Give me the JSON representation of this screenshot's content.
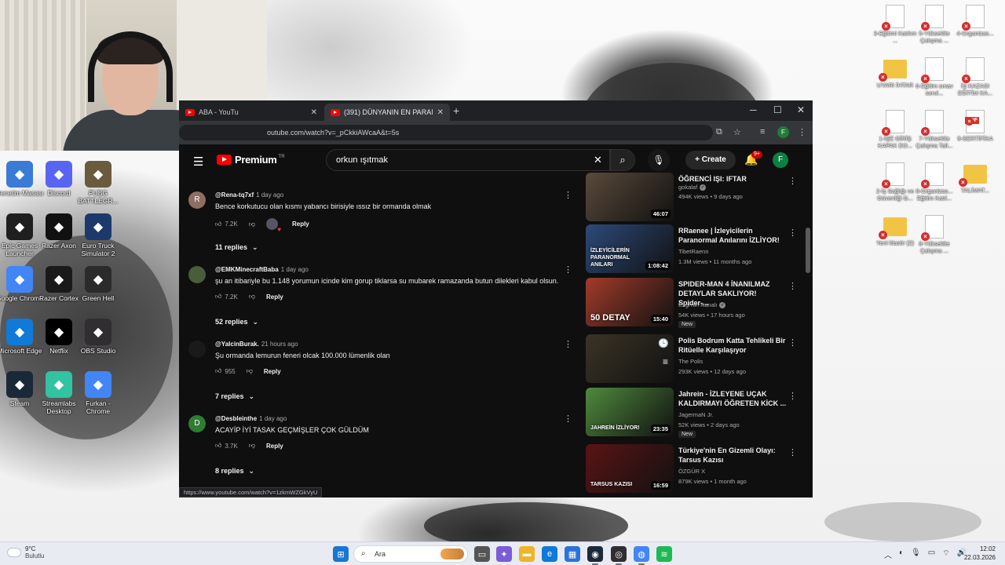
{
  "desktop": {
    "left_icons": [
      {
        "label": "Denetim Masası",
        "icon": "control-panel-icon",
        "color": "#3a7bd5"
      },
      {
        "label": "Discord",
        "icon": "discord-icon",
        "color": "#5865f2"
      },
      {
        "label": "PUBG BATTLEGR...",
        "icon": "pubg-icon",
        "color": "#6b5b3e"
      },
      {
        "label": "Epic Games Launcher",
        "icon": "epic-games-icon",
        "color": "#1f1f1f"
      },
      {
        "label": "Razer Axon",
        "icon": "razer-axon-icon",
        "color": "#111111"
      },
      {
        "label": "Euro Truck Simulator 2",
        "icon": "euro-truck-icon",
        "color": "#1b3a6b"
      },
      {
        "label": "Google Chrome",
        "icon": "chrome-icon",
        "color": "#4285f4"
      },
      {
        "label": "Razer Cortex",
        "icon": "razer-cortex-icon",
        "color": "#1a1a1a"
      },
      {
        "label": "Green Hell",
        "icon": "green-hell-icon",
        "color": "#2b2b2b"
      },
      {
        "label": "Microsoft Edge",
        "icon": "edge-icon",
        "color": "#0f7ad8"
      },
      {
        "label": "Netflix",
        "icon": "netflix-icon",
        "color": "#000000"
      },
      {
        "label": "OBS Studio",
        "icon": "obs-icon",
        "color": "#302e31"
      },
      {
        "label": "Steam",
        "icon": "steam-icon",
        "color": "#1b2838"
      },
      {
        "label": "Streamlabs Desktop",
        "icon": "streamlabs-icon",
        "color": "#31c3a2"
      },
      {
        "label": "Furkan - Chrome",
        "icon": "chrome-profile-icon",
        "color": "#4285f4"
      }
    ],
    "right_icons": [
      {
        "label": "3-Eğitimi Katılım ...",
        "kind": "doc"
      },
      {
        "label": "5-Yükseklte Çalışma ...",
        "kind": "doc"
      },
      {
        "label": "4-Organizas...",
        "kind": "doc"
      },
      {
        "label": "UYARI İHTAR",
        "kind": "folder"
      },
      {
        "label": "6-Eğitim sınav sorul...",
        "kind": "doc"
      },
      {
        "label": "İŞ KAZASI EĞİTİM KA...",
        "kind": "doc"
      },
      {
        "label": "1-İŞE GİRİŞ KAPAK DO...",
        "kind": "doc"
      },
      {
        "label": "7-Yükseklte Çalışma Tali...",
        "kind": "doc"
      },
      {
        "label": "9-SERTİFİKA",
        "kind": "pdf"
      },
      {
        "label": "2-İş Sağlığı ve Güvenliği G...",
        "kind": "doc"
      },
      {
        "label": "8-Organizas... Eğitim Katıl...",
        "kind": "doc"
      },
      {
        "label": "TALİMAT...",
        "kind": "folder"
      },
      {
        "label": "Yeni klasör (2)",
        "kind": "folder"
      },
      {
        "label": "8-Yükseklte Çalışma ...",
        "kind": "doc"
      }
    ]
  },
  "browser": {
    "tabs": [
      {
        "label": "ABA - YouTu",
        "active": false
      },
      {
        "label": "(391) DÜNYANIN EN PARANOR",
        "active": true
      }
    ],
    "url": "outube.com/watch?v=_pCkkiAWcaA&t=5s",
    "status_url": "https://www.youtube.com/watch?v=1zkmWZGkVyU"
  },
  "youtube": {
    "logo_text": "Premium",
    "country_code": "TR",
    "search_query": "orkun ışıtmak",
    "create_label": "Create",
    "notification_count": "9+",
    "avatar_letter": "F",
    "comments": [
      {
        "avatar_letter": "R",
        "avatar_color": "#8d6e63",
        "author": "@Rena-tq7xf",
        "time": "1 day ago",
        "text": "Bence korkutucu olan kısmı yabancı birisiyle ıssız bir ormanda olmak",
        "likes": "7.2K",
        "hearted": true,
        "reply_label": "Reply",
        "replies": "11 replies"
      },
      {
        "avatar_letter": "",
        "avatar_color": "#4a5d3a",
        "author": "@EMKMinecraftBaba",
        "time": "1 day ago",
        "text": "şu an itibariyle bu 1.148 yorumun icinde kim gorup tiklarsa su mubarek ramazanda butun dilekleri kabul olsun.",
        "likes": "7.2K",
        "hearted": false,
        "reply_label": "Reply",
        "replies": "52 replies"
      },
      {
        "avatar_letter": "",
        "avatar_color": "#1a1a1a",
        "author": "@YalcinBurak.",
        "time": "21 hours ago",
        "text": "Şu ormanda lemurun feneri olcak 100.000 lümenlik olan",
        "likes": "955",
        "hearted": false,
        "reply_label": "Reply",
        "replies": "7 replies"
      },
      {
        "avatar_letter": "D",
        "avatar_color": "#2e7d32",
        "author": "@Desbleinthe",
        "time": "1 day ago",
        "text": "ACAYİP İYİ TASAK GEÇMİŞLER ÇOK GÜLDÜM",
        "likes": "3.7K",
        "hearted": false,
        "reply_label": "Reply",
        "replies": "8 replies"
      }
    ],
    "recommendations": [
      {
        "title": "ÖĞRENCİ IŞI: IFTAR",
        "channel": "gokalaf",
        "verified": true,
        "views": "494K views",
        "age": "9 days ago",
        "duration": "46:07",
        "new": false,
        "thumb": "#5a4a3a"
      },
      {
        "title": "RRaenee | İzleyicilerin Paranormal Anılarını İZLİYOR!",
        "channel": "TibetRaenn",
        "verified": false,
        "views": "1.3M views",
        "age": "11 months ago",
        "duration": "1:08:42",
        "new": false,
        "thumb": "#2d4a7a"
      },
      {
        "title": "SPIDER-MAN 4 İNANILMAZ DETAYLAR SAKLIYOR! Spider-...",
        "channel": "Ezgi'nin Kanalı",
        "verified": true,
        "views": "54K views",
        "age": "17 hours ago",
        "duration": "15:40",
        "new": true,
        "thumb": "#a33b2a"
      },
      {
        "title": "Polis Bodrum Katta Tehlikeli Bir Ritüelle Karşılaşıyor",
        "channel": "The Polis",
        "verified": false,
        "views": "293K views",
        "age": "12 days ago",
        "duration": "",
        "new": false,
        "thumb": "#3b3426"
      },
      {
        "title": "Jahrein - İZLEYENE UÇAK KALDIRMAYI ÖĞRETEN KİCK ...",
        "channel": "JagermaN Jr.",
        "verified": false,
        "views": "52K views",
        "age": "2 days ago",
        "duration": "23:35",
        "new": true,
        "thumb": "#4f8a3c"
      },
      {
        "title": "Türkiye'nin En Gizemli Olayı: Tarsus Kazısı",
        "channel": "ÖZGÜR X",
        "verified": false,
        "views": "879K views",
        "age": "1 month ago",
        "duration": "16:59",
        "new": false,
        "thumb": "#5a1414",
        "overlay": "TARSUS KAZISI"
      }
    ],
    "thumb_overlays": {
      "rec2": "İZLEYİCİLERİN PARANORMAL ANILARI",
      "rec3": "50 DETAY",
      "rec5": "JAHREİN İZLİYOR!"
    }
  },
  "taskbar": {
    "weather_temp": "9°C",
    "weather_desc": "Bulutlu",
    "search_placeholder": "Ara",
    "time": "12:02",
    "date": "22.03.2026"
  }
}
